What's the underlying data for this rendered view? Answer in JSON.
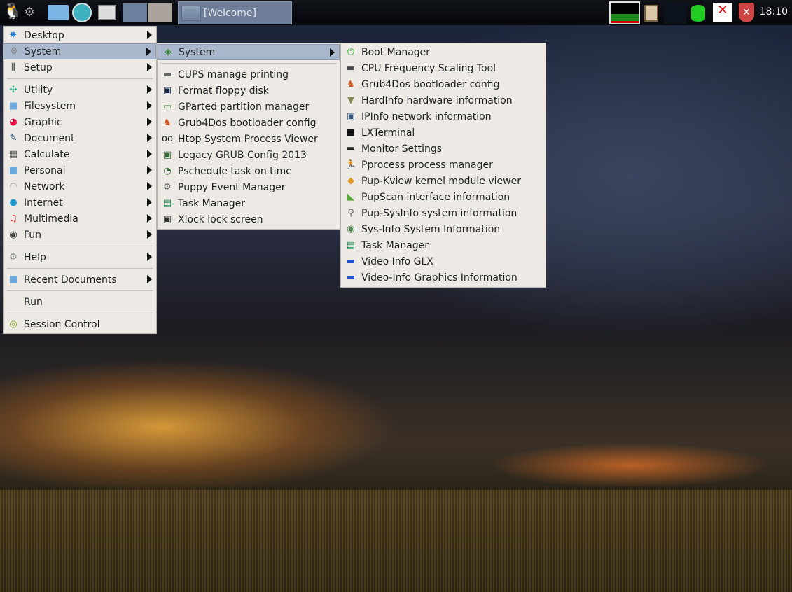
{
  "taskbar": {
    "window_button": "[Welcome]",
    "clock": "18:10"
  },
  "main_menu": {
    "items": [
      "Desktop",
      "System",
      "Setup",
      "Utility",
      "Filesystem",
      "Graphic",
      "Document",
      "Calculate",
      "Personal",
      "Network",
      "Internet",
      "Multimedia",
      "Fun",
      "Help",
      "Recent Documents",
      "Run",
      "Session Control"
    ]
  },
  "system_menu": {
    "header": "System",
    "items": [
      "CUPS manage printing",
      "Format floppy disk",
      "GParted partition manager",
      "Grub4Dos bootloader config",
      "Htop System Process Viewer",
      "Legacy GRUB Config 2013",
      "Pschedule task on time",
      "Puppy Event Manager",
      "Task Manager",
      "Xlock lock screen"
    ]
  },
  "system_submenu": {
    "items": [
      "Boot Manager",
      "CPU Frequency Scaling Tool",
      "Grub4Dos bootloader config",
      "HardInfo hardware information",
      "IPInfo network information",
      "LXTerminal",
      "Monitor Settings",
      "Pprocess process manager",
      "Pup-Kview kernel module viewer",
      "PupScan interface information",
      "Pup-SysInfo system information",
      "Sys-Info System Information",
      "Task Manager",
      "Video Info GLX",
      "Video-Info Graphics Information"
    ]
  },
  "colors": {
    "menu_bg": "#edeae5",
    "highlight": "#a9b8cc"
  }
}
